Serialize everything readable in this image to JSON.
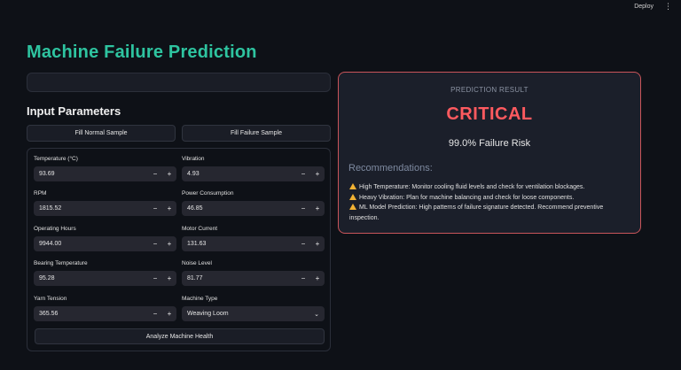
{
  "topbar": {
    "deploy_label": "Deploy",
    "menu_glyph": "⋮"
  },
  "page": {
    "title": "Machine Failure Prediction"
  },
  "input_section": {
    "title": "Input Parameters",
    "fill_normal_label": "Fill Normal Sample",
    "fill_failure_label": "Fill Failure Sample",
    "analyze_label": "Analyze Machine Health",
    "step_minus": "−",
    "step_plus": "+",
    "fields": {
      "temperature": {
        "label": "Temperature (°C)",
        "value": "93.69"
      },
      "vibration": {
        "label": "Vibration",
        "value": "4.93"
      },
      "rpm": {
        "label": "RPM",
        "value": "1815.52"
      },
      "power": {
        "label": "Power Consumption",
        "value": "46.85"
      },
      "hours": {
        "label": "Operating Hours",
        "value": "9944.00"
      },
      "current": {
        "label": "Motor Current",
        "value": "131.63"
      },
      "bearing": {
        "label": "Bearing Temperature",
        "value": "95.28"
      },
      "noise": {
        "label": "Noise Level",
        "value": "81.77"
      },
      "yarn": {
        "label": "Yarn Tension",
        "value": "365.56"
      },
      "machine_type": {
        "label": "Machine Type",
        "value": "Weaving Loom",
        "chevron": "⌄"
      }
    }
  },
  "result": {
    "heading": "PREDICTION RESULT",
    "status": "CRITICAL",
    "risk": "99.0% Failure Risk",
    "recommendations_title": "Recommendations:",
    "recommendations": [
      "High Temperature: Monitor cooling fluid levels and check for ventilation blockages.",
      "Heavy Vibration: Plan for machine balancing and check for loose components.",
      "ML Model Prediction: High patterns of failure signature detected. Recommend preventive inspection."
    ]
  },
  "colors": {
    "background": "#0e1117",
    "title_accent": "#2ec4a0",
    "critical": "#ff5a5f",
    "card_border": "#c9555a",
    "warning": "#f2b233"
  },
  "icons": {
    "recommendation_bullet": "warning-icon"
  }
}
